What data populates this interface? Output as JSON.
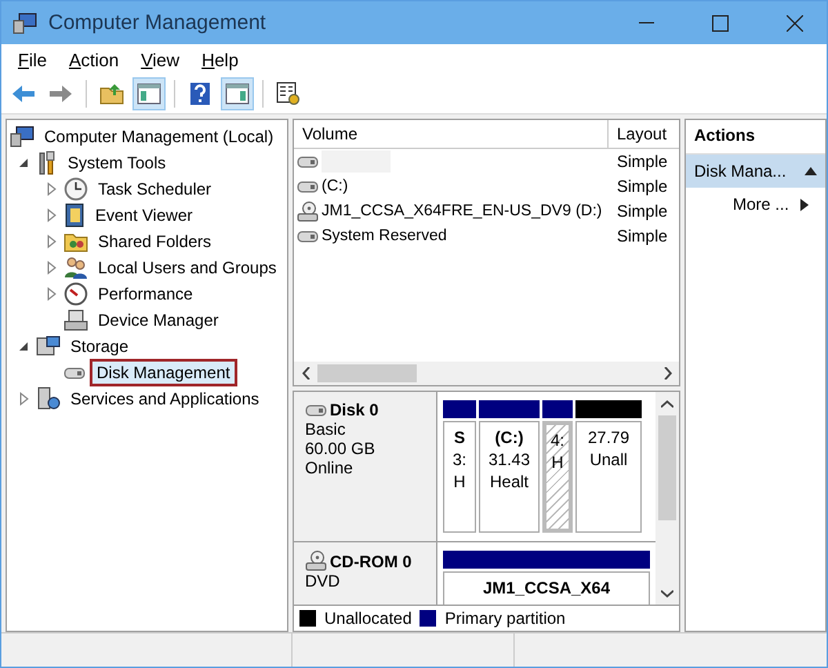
{
  "window": {
    "title": "Computer Management"
  },
  "menu": [
    {
      "label": "File"
    },
    {
      "label": "Action"
    },
    {
      "label": "View"
    },
    {
      "label": "Help"
    }
  ],
  "toolbar": [
    {
      "kind": "back",
      "pressed": false
    },
    {
      "kind": "forward",
      "pressed": false
    },
    {
      "kind": "sep"
    },
    {
      "kind": "up",
      "pressed": false
    },
    {
      "kind": "tree",
      "pressed": true
    },
    {
      "kind": "sep"
    },
    {
      "kind": "help",
      "pressed": false
    },
    {
      "kind": "pane",
      "pressed": true
    },
    {
      "kind": "sep"
    },
    {
      "kind": "props",
      "pressed": false
    }
  ],
  "tree": [
    {
      "label": "Computer Management (Local)",
      "selected": false,
      "children": [
        {
          "label": "System Tools",
          "expanded": true,
          "selected": false,
          "children": [
            {
              "label": "Task Scheduler",
              "expanded": false,
              "selected": false
            },
            {
              "label": "Event Viewer",
              "expanded": false,
              "selected": false
            },
            {
              "label": "Shared Folders",
              "expanded": false,
              "selected": false
            },
            {
              "label": "Local Users and Groups",
              "expanded": false,
              "selected": false
            },
            {
              "label": "Performance",
              "expanded": false,
              "selected": false
            },
            {
              "label": "Device Manager",
              "selected": false
            }
          ]
        },
        {
          "label": "Storage",
          "expanded": true,
          "selected": false,
          "children": [
            {
              "label": "Disk Management",
              "selected": true
            }
          ]
        },
        {
          "label": "Services and Applications",
          "expanded": false,
          "selected": false
        }
      ]
    }
  ],
  "volumes": {
    "columns": [
      "Volume",
      "Layout"
    ],
    "rows": [
      {
        "kind": "disk",
        "layout": "Simple"
      },
      {
        "kind": "disk",
        "volume": "(C:)",
        "layout": "Simple"
      },
      {
        "kind": "cd",
        "volume": "JM1_CCSA_X64FRE_EN-US_DV9 (D:)",
        "layout": "Simple"
      },
      {
        "kind": "disk",
        "volume": "System Reserved",
        "layout": "Simple"
      }
    ]
  },
  "disks": [
    {
      "kind": "disk",
      "name": "Disk 0",
      "lines": [
        "Basic",
        "60.00 GB",
        "Online"
      ],
      "partitions": [
        {
          "kind": "primary",
          "selected": false,
          "name": "S",
          "lines": [
            "3:",
            "H"
          ]
        },
        {
          "kind": "primary",
          "selected": false,
          "name": "(C:)",
          "lines": [
            "31.43",
            "Healt"
          ]
        },
        {
          "kind": "primary",
          "selected": true,
          "lines": [
            "4:",
            "H"
          ]
        },
        {
          "kind": "unallocated",
          "selected": false,
          "lines": [
            "27.79",
            "Unall"
          ]
        }
      ]
    },
    {
      "kind": "cd",
      "name": "CD-ROM 0",
      "lines": [
        "DVD"
      ],
      "partitions": [
        {
          "kind": "primary",
          "selected": false,
          "name": "JM1_CCSA_X64"
        }
      ]
    }
  ],
  "legend": [
    {
      "label": "Unallocated",
      "color": "#000000"
    },
    {
      "label": "Primary partition",
      "color": "#000080"
    }
  ],
  "actions": {
    "title": "Actions",
    "items": [
      {
        "kind": "section",
        "label": "Disk Mana..."
      },
      {
        "kind": "submenu",
        "label": "More ..."
      }
    ]
  }
}
